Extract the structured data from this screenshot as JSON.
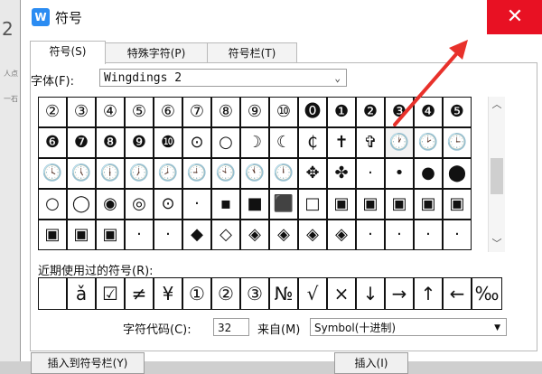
{
  "background": {
    "page_number": "2",
    "text_line_1": "人点",
    "text_line_2": "一石"
  },
  "window": {
    "title": "符号",
    "app_icon_letter": "W",
    "close_glyph": "✕"
  },
  "tabs": [
    {
      "label": "符号(S)",
      "active": true
    },
    {
      "label": "特殊字符(P)",
      "active": false
    },
    {
      "label": "符号栏(T)",
      "active": false
    }
  ],
  "font": {
    "label": "字体(F):",
    "value": "Wingdings 2"
  },
  "symbol_grid": [
    [
      "②",
      "③",
      "④",
      "⑤",
      "⑥",
      "⑦",
      "⑧",
      "⑨",
      "⑩",
      "⓿",
      "❶",
      "❷",
      "❸",
      "❹",
      "❺"
    ],
    [
      "❻",
      "❼",
      "❽",
      "❾",
      "❿",
      "⊙",
      "○",
      "☽",
      "☾",
      "₵",
      "✝",
      "✞",
      "🕐",
      "🕑",
      "🕒"
    ],
    [
      "🕓",
      "🕔",
      "🕕",
      "🕖",
      "🕗",
      "🕘",
      "🕙",
      "🕚",
      "🕛",
      "✥",
      "✤",
      "·",
      "•",
      "●",
      "⬤"
    ],
    [
      "○",
      "◯",
      "◉",
      "◎",
      "⊙",
      "·",
      "▪",
      "■",
      "⬛",
      "□",
      "▣",
      "▣",
      "▣",
      "▣",
      "▣"
    ],
    [
      "▣",
      "▣",
      "▣",
      "·",
      "·",
      "◆",
      "◇",
      "◈",
      "◈",
      "◈",
      "◈",
      "·",
      "·",
      "·",
      "·"
    ]
  ],
  "recent": {
    "label": "近期使用过的符号(R):",
    "items": [
      "",
      "ǎ",
      "☑",
      "≠",
      "¥",
      "①",
      "②",
      "③",
      "№",
      "√",
      "×",
      "↓",
      "→",
      "↑",
      "←",
      "‰"
    ]
  },
  "code": {
    "label": "字符代码(C):",
    "value": "32",
    "from_label": "来自(M)",
    "from_value": "Symbol(十进制)"
  },
  "buttons": {
    "insert_to_toolbar": "插入到符号栏(Y)",
    "insert": "插入(I)"
  },
  "colors": {
    "close_bg": "#e81123",
    "arrow": "#e8312b",
    "app_icon": "#2b8cf2"
  }
}
